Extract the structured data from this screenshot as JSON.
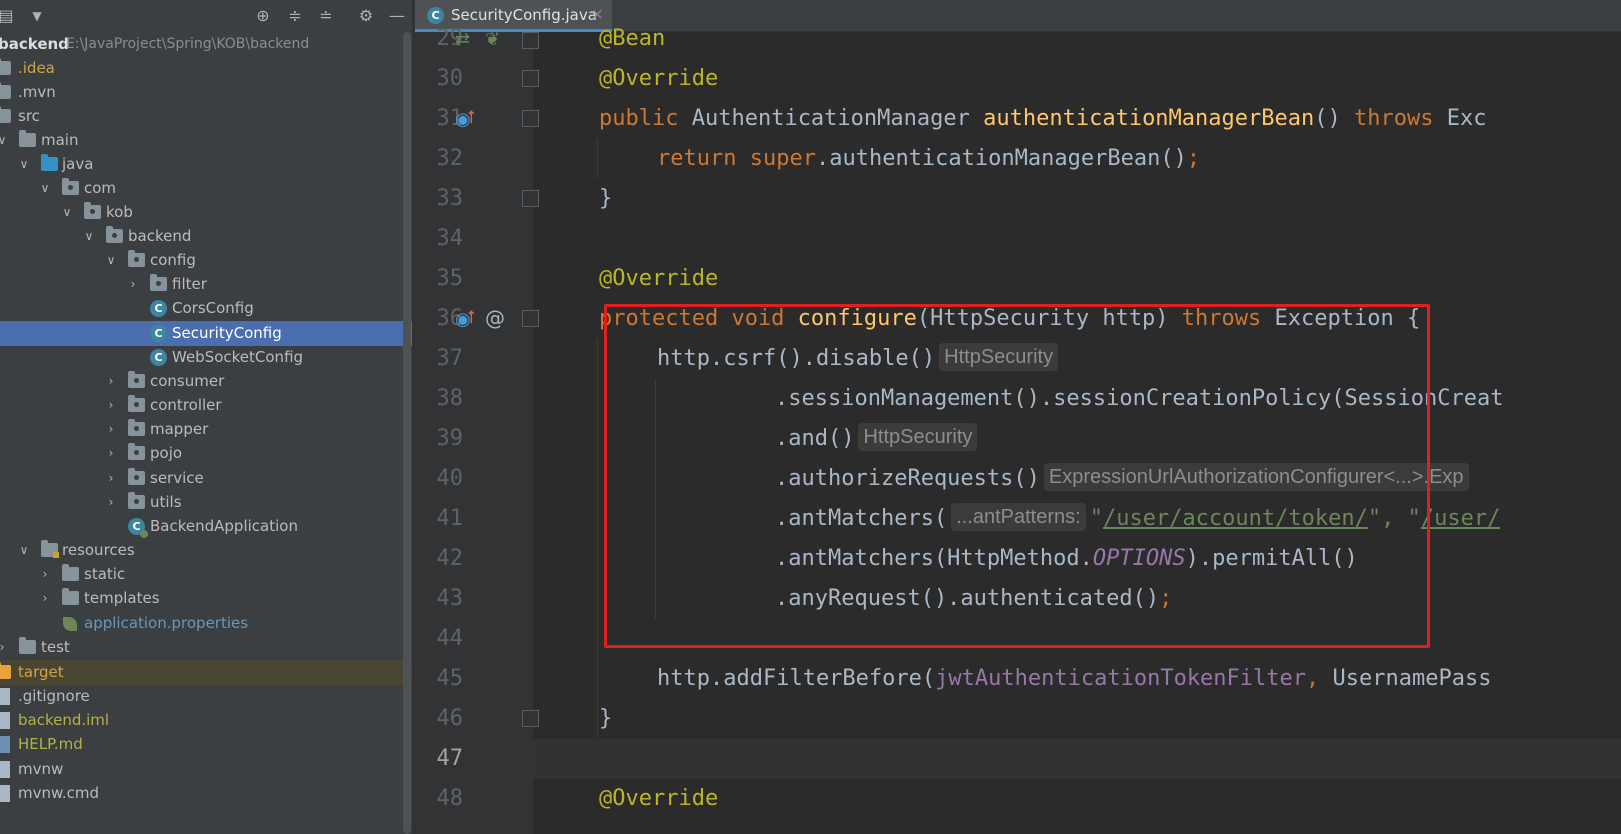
{
  "project": {
    "toolbar_icons": [
      "menu-icon",
      "chevron-down-icon",
      "locate-icon",
      "expand-all-icon",
      "collapse-all-icon",
      "gear-icon",
      "minimize-icon"
    ],
    "root": {
      "name": "backend",
      "path": "E:\\JavaProject\\Spring\\KOB\\backend"
    },
    "tree": [
      {
        "label": ".idea"
      },
      {
        "label": ".mvn"
      },
      {
        "label": "src"
      },
      {
        "label": "main"
      },
      {
        "label": "java"
      },
      {
        "label": "com"
      },
      {
        "label": "kob"
      },
      {
        "label": "backend"
      },
      {
        "label": "config"
      },
      {
        "label": "filter"
      },
      {
        "label": "CorsConfig"
      },
      {
        "label": "SecurityConfig"
      },
      {
        "label": "WebSocketConfig"
      },
      {
        "label": "consumer"
      },
      {
        "label": "controller"
      },
      {
        "label": "mapper"
      },
      {
        "label": "pojo"
      },
      {
        "label": "service"
      },
      {
        "label": "utils"
      },
      {
        "label": "BackendApplication"
      },
      {
        "label": "resources"
      },
      {
        "label": "static"
      },
      {
        "label": "templates"
      },
      {
        "label": "application.properties"
      },
      {
        "label": "test"
      },
      {
        "label": "target"
      },
      {
        "label": ".gitignore"
      },
      {
        "label": "backend.iml"
      },
      {
        "label": "HELP.md"
      },
      {
        "label": "mvnw"
      },
      {
        "label": "mvnw.cmd"
      }
    ]
  },
  "editor": {
    "tab": {
      "label": "SecurityConfig.java",
      "close": "×"
    },
    "line_numbers": [
      "29",
      "30",
      "31",
      "32",
      "33",
      "34",
      "35",
      "36",
      "37",
      "38",
      "39",
      "40",
      "41",
      "42",
      "43",
      "44",
      "45",
      "46",
      "47",
      "48"
    ],
    "current_line": "47",
    "gutter_marks": {
      "override_up": "⭡",
      "at": "@"
    },
    "code": {
      "l29": "@Bean",
      "l30": "@Override",
      "l31_kw": "public",
      "l31_type": " AuthenticationManager ",
      "l31_fn": "authenticationManagerBean",
      "l31_rest": "() ",
      "l31_throws": "throws",
      "l31_tail": " Exc",
      "l32_kw": "return",
      "l32_super": " super",
      "l32_rest": ".authenticationManagerBean()",
      "l32_semi": ";",
      "l33": "}",
      "l35": "@Override",
      "l36_kw": "protected void",
      "l36_fn": " configure",
      "l36_rest": "(HttpSecurity http) ",
      "l36_throws": "throws",
      "l36_tail": " Exception {",
      "l37": "http.csrf().disable()",
      "l37_hint": "HttpSecurity",
      "l38": ".sessionManagement().sessionCreationPolicy(SessionCreat",
      "l39": ".and()",
      "l39_hint": "HttpSecurity",
      "l40": ".authorizeRequests()",
      "l40_hint": "ExpressionUrlAuthorizationConfigurer<...>.Exp",
      "l41": ".antMatchers(",
      "l41_hint": "...antPatterns:",
      "l41_s1q": "\"",
      "l41_s1": "/user/account/token/",
      "l41_sep": "\", \"",
      "l41_s2": "/user/",
      "l42_a": ".antMatchers(HttpMethod.",
      "l42_const": "OPTIONS",
      "l42_b": ").permitAll()",
      "l43": ".anyRequest().authenticated()",
      "l43_semi": ";",
      "l45_a": "http.addFilterBefore(",
      "l45_fld": "jwtAuthenticationTokenFilter",
      "l45_comma": ",",
      "l45_b": " UsernamePass",
      "l46": "}",
      "l48": "@Override"
    }
  },
  "colors": {
    "highlight_box": "#e02020",
    "selection": "#4b6eaf",
    "keyword": "#cc7832",
    "annotation": "#bbb529",
    "method": "#ffc66d",
    "string": "#6a8759"
  }
}
